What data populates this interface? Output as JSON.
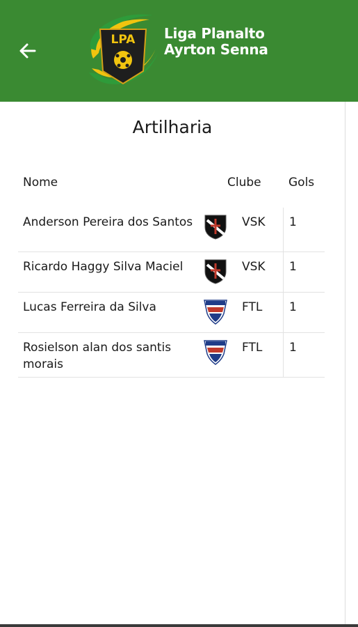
{
  "header": {
    "title_line1": "Liga Planalto",
    "title_line2": "Ayrton Senna",
    "logo_text": "LPA",
    "back_icon": "arrow-left-icon",
    "colors": {
      "appbar": "#3a8a32",
      "logo_yellow": "#f1c40f",
      "logo_green": "#2e9b3a"
    }
  },
  "page": {
    "title": "Artilharia"
  },
  "table": {
    "headers": {
      "name": "Nome",
      "club": "Clube",
      "goals": "Gols"
    },
    "rows": [
      {
        "name": "Anderson Pereira dos Santos",
        "crest": "vasco-crest-icon",
        "club": "VSK",
        "goals": "1"
      },
      {
        "name": "Ricardo Haggy Silva Maciel",
        "crest": "vasco-crest-icon",
        "club": "VSK",
        "goals": "1"
      },
      {
        "name": "Lucas Ferreira da Silva",
        "crest": "fortaleza-crest-icon",
        "club": "FTL",
        "goals": "1"
      },
      {
        "name": "Rosielson alan dos santis morais",
        "crest": "fortaleza-crest-icon",
        "club": "FTL",
        "goals": "1"
      }
    ]
  }
}
